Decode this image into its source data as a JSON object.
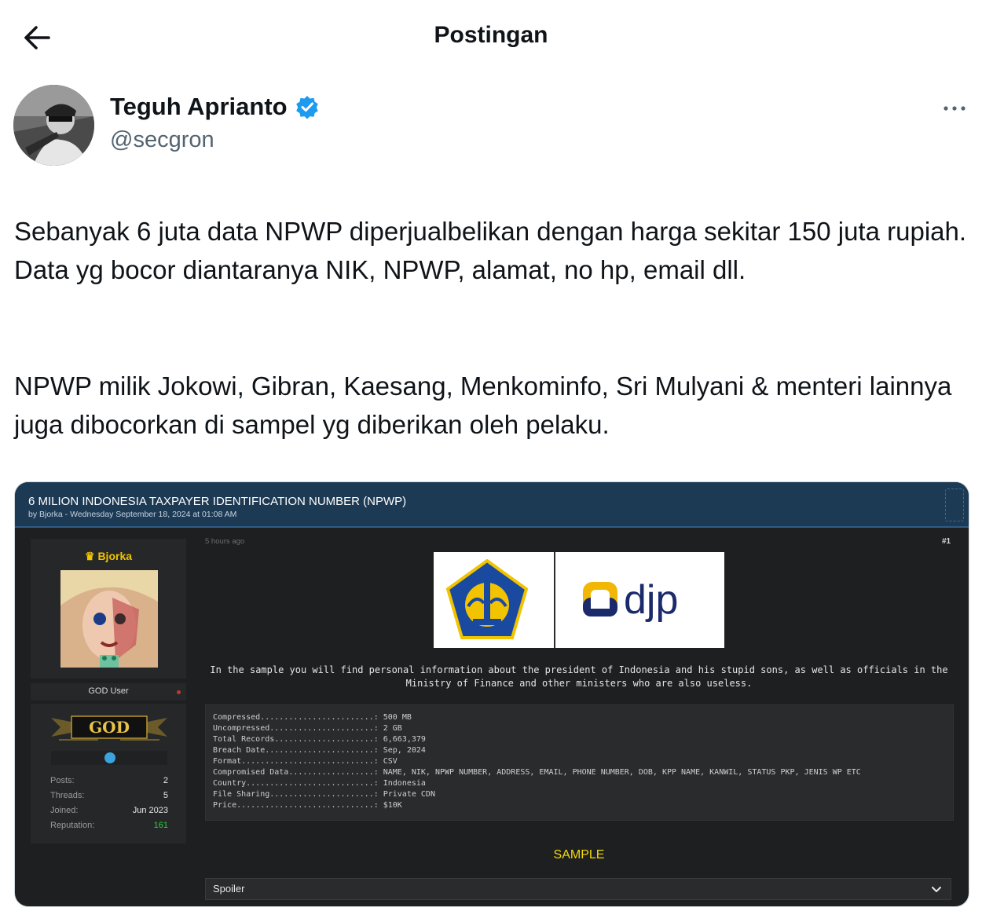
{
  "header": {
    "title": "Postingan"
  },
  "author": {
    "name": "Teguh Aprianto",
    "handle": "@secgron",
    "verified": true
  },
  "tweet": {
    "paragraph1": "Sebanyak 6 juta data NPWP diperjualbelikan dengan harga sekitar 150 juta rupiah. Data yg bocor diantaranya NIK, NPWP, alamat, no hp, email dll.",
    "paragraph2": "NPWP milik Jokowi, Gibran, Kaesang, Menkominfo, Sri Mulyani & menteri lainnya juga dibocorkan di sampel yg diberikan oleh pelaku."
  },
  "forum": {
    "thread_title": "6 MILION INDONESIA TAXPAYER IDENTIFICATION NUMBER (NPWP)",
    "thread_sub": "by Bjorka - Wednesday September 18, 2024 at 01:08 AM",
    "user": {
      "name": "Bjorka",
      "role": "GOD User",
      "badge": "GOD",
      "stats": [
        {
          "label": "Posts:",
          "value": "2"
        },
        {
          "label": "Threads:",
          "value": "5"
        },
        {
          "label": "Joined:",
          "value": "Jun 2023"
        },
        {
          "label": "Reputation:",
          "value": "161"
        }
      ]
    },
    "post_time": "5 hours ago",
    "post_number": "#1",
    "logo_text": "djp",
    "intro": "In the sample you will find personal information about the president of Indonesia and his stupid sons, as well as officials in the Ministry of Finance and other ministers who are also useless.",
    "details": [
      {
        "key": "Compressed........................",
        "value": ": 500 MB"
      },
      {
        "key": "Uncompressed......................",
        "value": ": 2 GB"
      },
      {
        "key": "Total Records.....................",
        "value": ": 6,663,379"
      },
      {
        "key": "Breach Date.......................",
        "value": ": Sep, 2024"
      },
      {
        "key": "Format............................",
        "value": ": CSV"
      },
      {
        "key": "Compromised Data..................",
        "value": ": NAME, NIK, NPWP NUMBER, ADDRESS, EMAIL, PHONE NUMBER, DOB, KPP NAME, KANWIL, STATUS PKP, JENIS WP ETC"
      },
      {
        "key": "Country...........................",
        "value": ": Indonesia"
      },
      {
        "key": "File Sharing......................",
        "value": ": Private CDN"
      },
      {
        "key": "Price.............................",
        "value": ": $10K"
      }
    ],
    "sample_label": "SAMPLE",
    "spoiler_label": "Spoiler"
  },
  "colors": {
    "accent": "#1d9bf0",
    "forum_header": "#1d3a55",
    "sample": "#f5d90a"
  }
}
